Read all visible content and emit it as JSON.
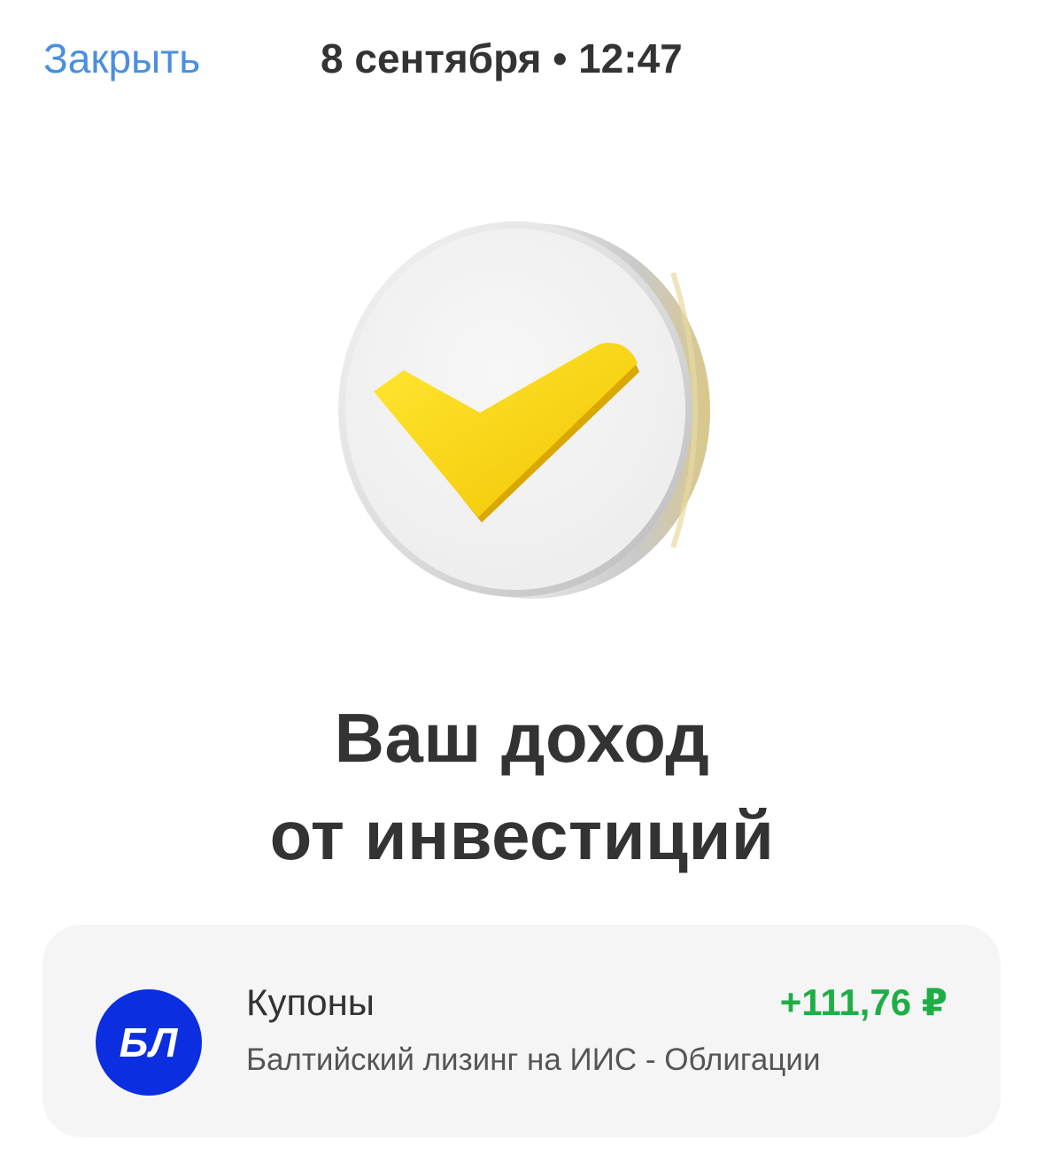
{
  "header": {
    "close_label": "Закрыть",
    "datetime": "8 сентября • 12:47"
  },
  "hero": {
    "icon": "yellow-checkmark-coin-icon",
    "check_color": "#ffdd2d",
    "coin_color": "#f3f3f3"
  },
  "title": {
    "line1": "Ваш доход",
    "line2": "от инвестиций"
  },
  "operation": {
    "avatar_text": "БЛ",
    "avatar_color": "#0a2ee0",
    "title": "Купоны",
    "amount": "+111,76 ₽",
    "amount_color": "#1fae46",
    "subtitle": "Балтийский лизинг на ИИС - Облигации"
  }
}
